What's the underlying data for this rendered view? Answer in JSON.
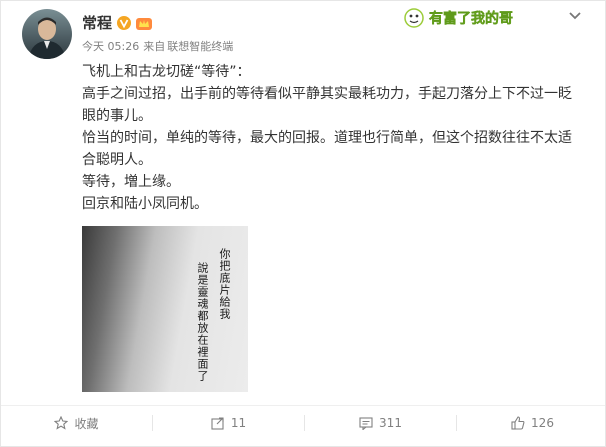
{
  "post": {
    "username": "常程",
    "timestamp": "今天 05:26",
    "source_prefix": "来自",
    "source": "联想智能终端",
    "paragraphs": [
      "飞机上和古龙切磋“等待”：",
      "高手之间过招，出手前的等待看似平静其实最耗功力，手起刀落分上下不过一眨眼的事儿。",
      "恰当的时间，单纯的等待，最大的回报。道理也行简单，但这个招数往往不太适合聪明人。",
      "等待，増上缘。",
      "回京和陆小凤同机。"
    ],
    "image_text": {
      "col1": "你把底片給我",
      "col2": "說是靈魂都放在裡面了"
    },
    "decor_text": "有富了我的哥"
  },
  "actions": {
    "favorite_label": "收藏",
    "repost_count": "11",
    "comment_count": "311",
    "like_count": "126"
  },
  "colors": {
    "accent": "#eb7350",
    "verified": "#f5a623",
    "muted": "#808080"
  },
  "icons": {
    "verified": "verified-badge-icon",
    "vip": "vip-crown-icon",
    "chevron": "chevron-down-icon",
    "favorite": "star-icon",
    "repost": "repost-arrow-icon",
    "comment": "comment-bubble-icon",
    "like": "thumbs-up-icon"
  }
}
